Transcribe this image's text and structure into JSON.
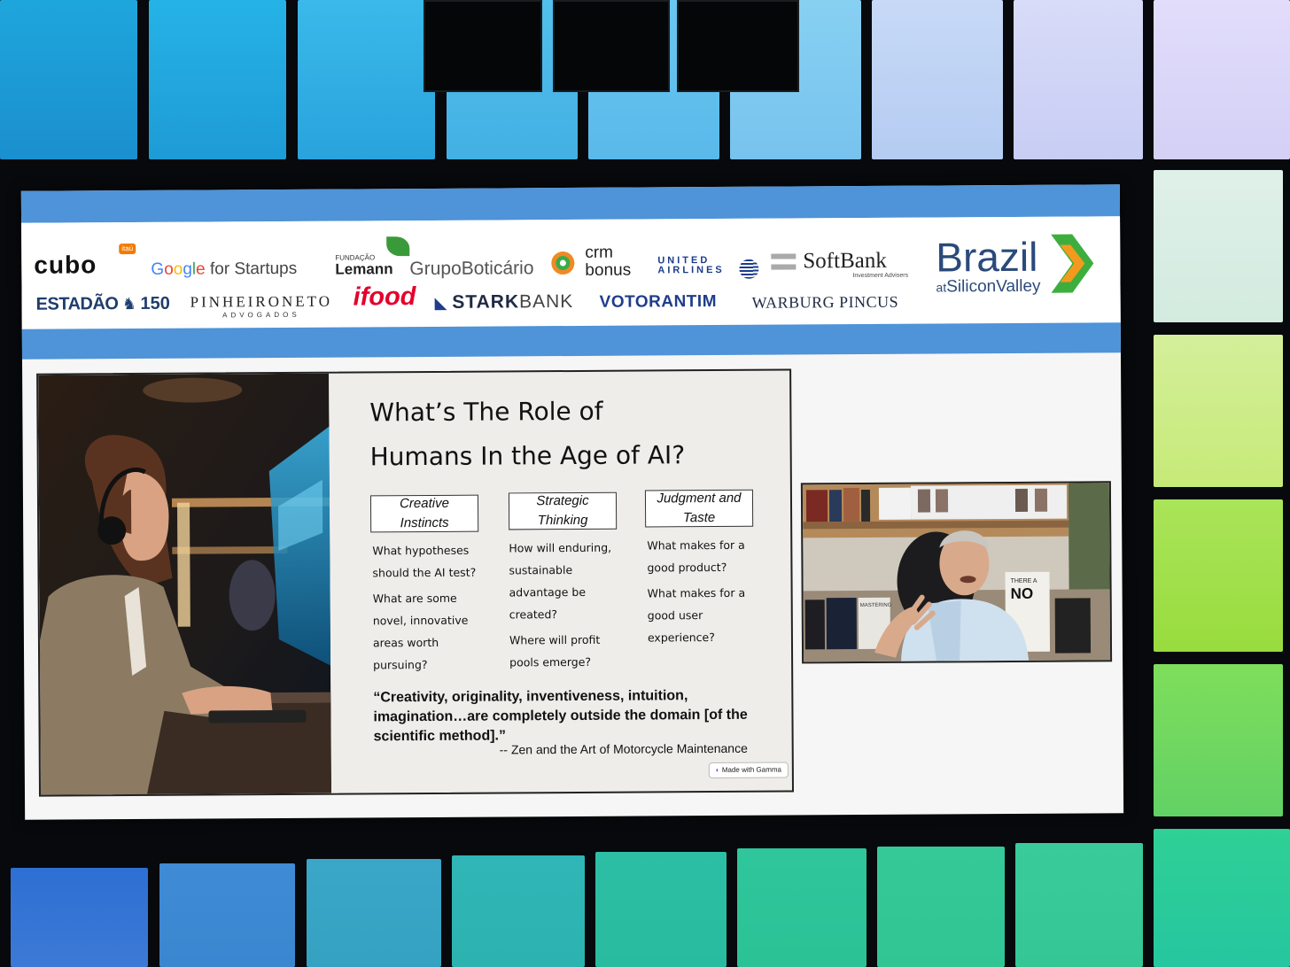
{
  "sponsors": {
    "cubo": "cubo",
    "itau": "itaú",
    "google": "Google",
    "google_suffix": "for Startups",
    "lemann_small": "FUNDAÇÃO",
    "lemann": "Lemann",
    "boticario": "GrupoBoticário",
    "crm": "crm",
    "bonus": "bonus",
    "united1": "UNITED",
    "united2": "AIRLINES",
    "softbank": "SoftBank",
    "softbank_sub": "Investment Advisers",
    "estadao": "ESTADÃO",
    "estadao_num": "150",
    "pinheiro": "PINHEIRONETO",
    "pinheiro_sub": "ADVOGADOS",
    "ifood": "ifood",
    "stark": "STARK",
    "bank": "BANK",
    "votorantim": "VOTORANTIM",
    "warburg": "WARBURG PINCUS"
  },
  "event": {
    "brazil": "Brazil",
    "at": "at",
    "siliconvalley": "SiliconValley"
  },
  "slide": {
    "title_line1": "What’s The Role of",
    "title_line2": "Humans In the Age of AI?",
    "columns": [
      {
        "head1": "Creative",
        "head2": "Instincts",
        "items": [
          "What hypotheses should the AI test?",
          "What are some novel, innovative areas worth pursuing?"
        ]
      },
      {
        "head1": "Strategic",
        "head2": "Thinking",
        "items": [
          "How will enduring, sustainable advantage be created?",
          "Where will profit pools emerge?"
        ]
      },
      {
        "head1": "Judgment and",
        "head2": "Taste",
        "items": [
          "What makes for a good product?",
          "What makes for a good user experience?"
        ]
      }
    ],
    "quote": "“Creativity, originality, inventiveness, intuition, imagination…are completely outside the domain [of the scientific method].”",
    "attribution": "-- Zen and the Art of Motorcycle Maintenance",
    "gamma_badge": "Made with Gamma"
  },
  "video_books": {
    "no": "NO",
    "there": "THERE A",
    "mastering": "MASTERING"
  },
  "colors": {
    "band_blue": "#4f93d8",
    "brazil_green": "#3dae3e",
    "brazil_orange": "#f39a1e",
    "ifood_red": "#e4002b"
  }
}
